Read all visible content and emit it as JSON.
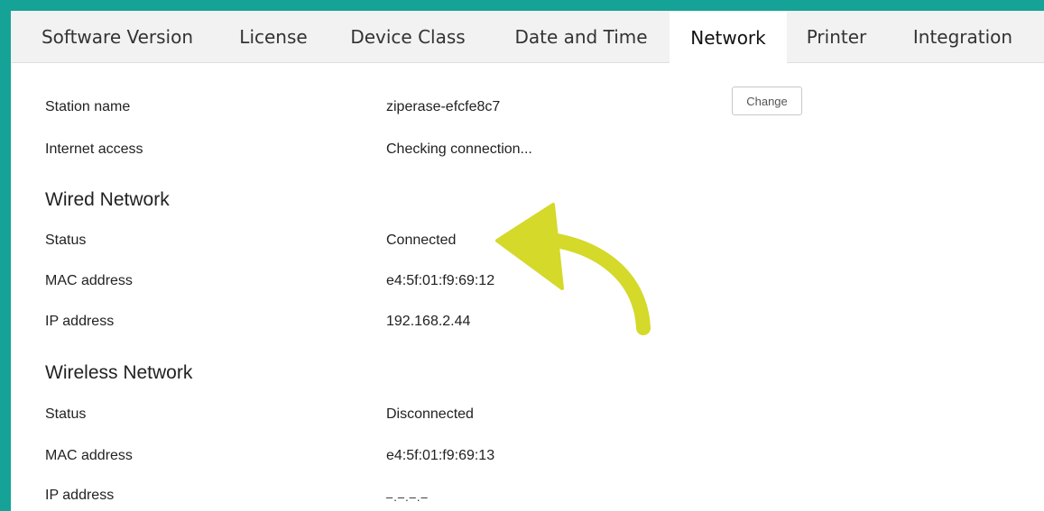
{
  "tabs": [
    {
      "label": "Software Version",
      "active": false
    },
    {
      "label": "License",
      "active": false
    },
    {
      "label": "Device Class",
      "active": false
    },
    {
      "label": "Date and Time",
      "active": false
    },
    {
      "label": "Network",
      "active": true
    },
    {
      "label": "Printer",
      "active": false
    },
    {
      "label": "Integration",
      "active": false
    }
  ],
  "station": {
    "label": "Station name",
    "value": "ziperase-efcfe8c7",
    "change_label": "Change"
  },
  "internet": {
    "label": "Internet access",
    "value": "Checking connection..."
  },
  "wired": {
    "title": "Wired Network",
    "status_label": "Status",
    "status_value": "Connected",
    "mac_label": "MAC address",
    "mac_value": "e4:5f:01:f9:69:12",
    "ip_label": "IP address",
    "ip_value": "192.168.2.44"
  },
  "wireless": {
    "title": "Wireless Network",
    "status_label": "Status",
    "status_value": "Disconnected",
    "mac_label": "MAC address",
    "mac_value": "e4:5f:01:f9:69:13",
    "ip_label": "IP address",
    "ip_value": "–.–.–.–"
  },
  "colors": {
    "frame": "#14a396",
    "arrow": "#d4d92a"
  },
  "annotation": {
    "icon": "curved-arrow-icon"
  }
}
